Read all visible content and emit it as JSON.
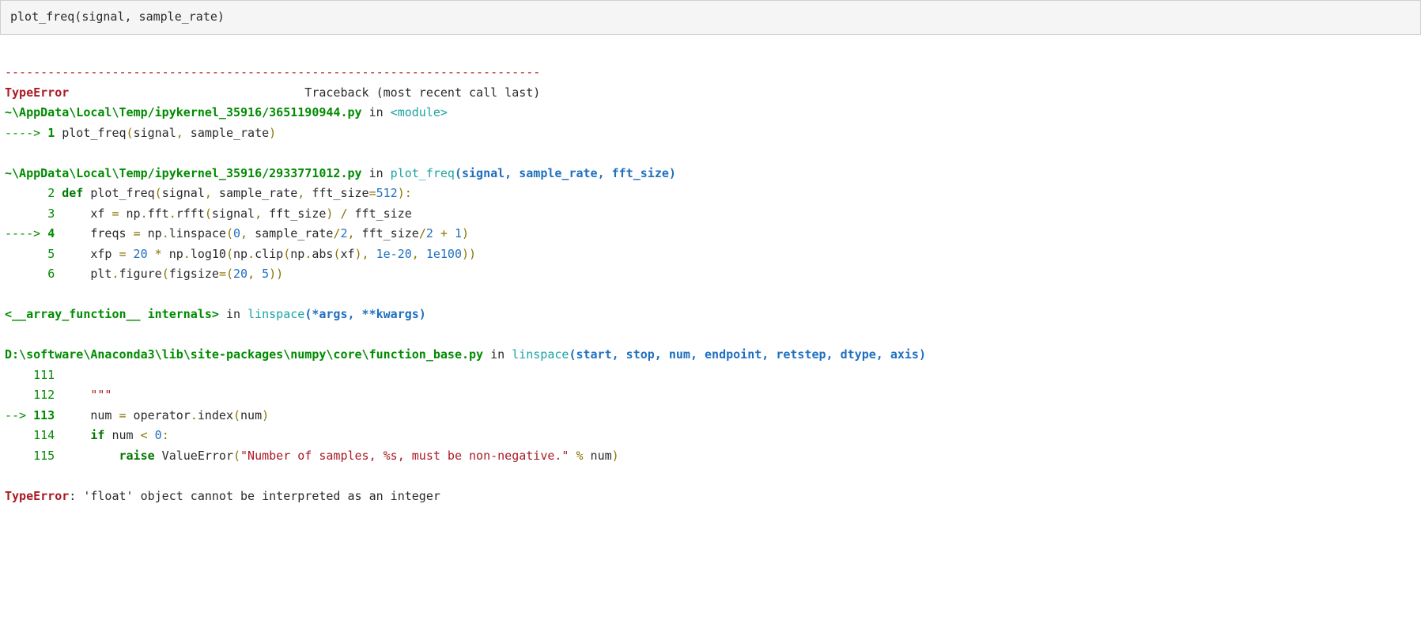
{
  "input": {
    "fn": "plot_freq",
    "open": "(",
    "args": "signal, sample_rate",
    "close": ")"
  },
  "tb": {
    "sep": "---------------------------------------------------------------------------",
    "error_name": "TypeError",
    "header_tail": "Traceback (most recent call last)",
    "f1_path": "~\\AppData\\Local\\Temp/ipykernel_35916/3651190944.py",
    "in": " in ",
    "f1_mod": "<module>",
    "arrow": "----> ",
    "indent6": "      ",
    "sparrow": "--> ",
    "f1_l1_num": "1",
    "f1_l1_a": " plot_freq",
    "f1_l1_b": "(",
    "f1_l1_c": "signal",
    "f1_l1_d": ",",
    "f1_l1_e": " sample_rate",
    "f1_l1_f": ")",
    "f2_path": "~\\AppData\\Local\\Temp/ipykernel_35916/2933771012.py",
    "f2_fn": "plot_freq",
    "f2_sig_open": "(signal, sample_rate, fft_size)",
    "f2_l2_num": "2",
    "f2_l2": " def plot_freq(signal, sample_rate, fft_size=512):",
    "f2_l2_def": " def",
    "f2_l2_rest": " plot_freq",
    "f2_l2_par": "(",
    "f2_l2_args": "signal",
    "f2_l2_c1": ",",
    "f2_l2_arg2": " sample_rate",
    "f2_l2_c2": ",",
    "f2_l2_arg3": " fft_size",
    "f2_l2_eq": "=",
    "f2_l2_num512": "512",
    "f2_l2_close": "):",
    "f2_l3_num": "3",
    "f2_l3_pre": "     xf ",
    "f2_l3_eq": "=",
    "f2_l3_a": " np",
    "f2_l3_b": ".",
    "f2_l3_c": "fft",
    "f2_l3_d": ".",
    "f2_l3_e": "rfft",
    "f2_l3_f": "(",
    "f2_l3_g": "signal",
    "f2_l3_h": ",",
    "f2_l3_i": " fft_size",
    "f2_l3_j": ")",
    "f2_l3_k": " /",
    "f2_l3_l": " fft_size",
    "f2_l4_num": "4",
    "f2_l4_pre": "     freqs ",
    "f2_l4_eq": "=",
    "f2_l4_a": " np",
    "f2_l4_b": ".",
    "f2_l4_c": "linspace",
    "f2_l4_d": "(",
    "f2_l4_e": "0",
    "f2_l4_f": ",",
    "f2_l4_g": " sample_rate",
    "f2_l4_h": "/",
    "f2_l4_i": "2",
    "f2_l4_j": ",",
    "f2_l4_k": " fft_size",
    "f2_l4_l": "/",
    "f2_l4_m": "2",
    "f2_l4_n": " +",
    "f2_l4_o": " 1",
    "f2_l4_p": ")",
    "f2_l5_num": "5",
    "f2_l5_pre": "     xfp ",
    "f2_l5_eq": "=",
    "f2_l5_a": " 20",
    "f2_l5_b": " *",
    "f2_l5_c": " np",
    "f2_l5_d": ".",
    "f2_l5_e": "log10",
    "f2_l5_f": "(",
    "f2_l5_g": "np",
    "f2_l5_h": ".",
    "f2_l5_i": "clip",
    "f2_l5_j": "(",
    "f2_l5_k": "np",
    "f2_l5_l": ".",
    "f2_l5_m": "abs",
    "f2_l5_n": "(",
    "f2_l5_o": "xf",
    "f2_l5_p": "),",
    "f2_l5_q": " 1e-20",
    "f2_l5_r": ",",
    "f2_l5_s": " 1e100",
    "f2_l5_t": "))",
    "f2_l6_num": "6",
    "f2_l6_pre": "     plt",
    "f2_l6_a": ".",
    "f2_l6_b": "figure",
    "f2_l6_c": "(",
    "f2_l6_d": "figsize",
    "f2_l6_e": "=(",
    "f2_l6_f": "20",
    "f2_l6_g": ",",
    "f2_l6_h": " 5",
    "f2_l6_i": "))",
    "f3_path": "<__array_function__ internals>",
    "f3_fn": "linspace",
    "f3_sig": "(*args, **kwargs)",
    "f4_path": "D:\\software\\Anaconda3\\lib\\site-packages\\numpy\\core\\function_base.py",
    "f4_fn": "linspace",
    "f4_sig": "(start, stop, num, endpoint, retstep, dtype, axis)",
    "f4_l111_num": "111",
    "f4_l111": "",
    "f4_l112_num": "112",
    "f4_l112": "     \"\"\"",
    "f4_l113_num": "113",
    "f4_l113_pre": "     num ",
    "f4_l113_eq": "=",
    "f4_l113_a": " operator",
    "f4_l113_b": ".",
    "f4_l113_c": "index",
    "f4_l113_d": "(",
    "f4_l113_e": "num",
    "f4_l113_f": ")",
    "f4_l114_num": "114",
    "f4_l114_if": "     if",
    "f4_l114_a": " num ",
    "f4_l114_lt": "<",
    "f4_l114_b": " 0",
    "f4_l114_c": ":",
    "f4_l115_num": "115",
    "f4_l115_raise": "         raise",
    "f4_l115_a": " ValueError",
    "f4_l115_b": "(",
    "f4_l115_c": "\"Number of samples, %s, must be non-negative.\"",
    "f4_l115_d": " %",
    "f4_l115_e": " num",
    "f4_l115_f": ")",
    "final_err": "TypeError",
    "final_msg": ": 'float' object cannot be interpreted as an integer"
  }
}
